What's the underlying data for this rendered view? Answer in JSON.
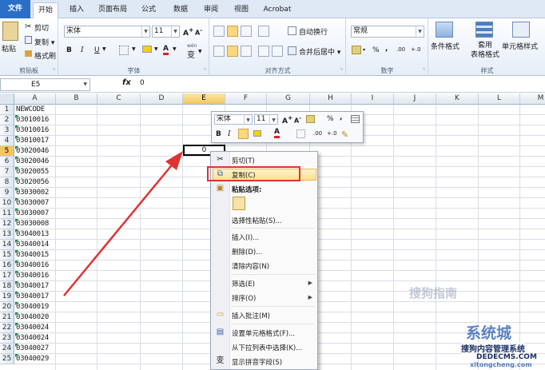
{
  "tabs": {
    "file": "文件",
    "home": "开始",
    "insert": "插入",
    "layout": "页面布局",
    "formula": "公式",
    "data": "数据",
    "review": "审阅",
    "view": "视图",
    "acrobat": "Acrobat"
  },
  "ribbon": {
    "clipboard": {
      "label": "剪贴板",
      "paste": "粘贴",
      "cut": "剪切",
      "copy": "复制 ▾",
      "painter": "格式刷"
    },
    "font": {
      "label": "字体",
      "name": "宋体",
      "size": "11",
      "bold": "B",
      "italic": "I",
      "underline": "U",
      "wen": "wén",
      "wen_char": "变"
    },
    "align": {
      "label": "对齐方式",
      "wrap": "自动换行",
      "merge": "合并后居中 ▾"
    },
    "number": {
      "label": "数字",
      "format": "常规",
      "currency": "▾",
      "percent": "%",
      "comma": ",",
      "dec_inc": ".00",
      "dec_dec": "+.0"
    },
    "styles": {
      "label": "样式",
      "cond": "条件格式",
      "table": "套用\n表格格式",
      "cell": "单元格样式"
    }
  },
  "formula_bar": {
    "name_box": "E5",
    "fx": "fx",
    "value": "0"
  },
  "columns": [
    "A",
    "B",
    "C",
    "D",
    "E",
    "F",
    "G",
    "H",
    "I",
    "J",
    "K",
    "L",
    "M"
  ],
  "rows": [
    "1",
    "2",
    "3",
    "4",
    "5",
    "6",
    "7",
    "8",
    "9",
    "10",
    "11",
    "12",
    "13",
    "14",
    "15",
    "16",
    "17",
    "18",
    "19",
    "20",
    "21",
    "22",
    "23",
    "24",
    "25"
  ],
  "cells_a": [
    "NEWCODE",
    "03010016",
    "03010016",
    "03010017",
    "03020046",
    "03020046",
    "03020055",
    "03020056",
    "03030002",
    "03030007",
    "03030007",
    "03030008",
    "03040013",
    "03040014",
    "03040015",
    "03040016",
    "03040016",
    "03040017",
    "03040017",
    "03040019",
    "03040020",
    "03040024",
    "03040024",
    "03040027",
    "03040029"
  ],
  "active_cell": {
    "ref": "E5",
    "value": "0"
  },
  "mini_toolbar": {
    "font": "宋体",
    "size": "11",
    "bold": "B",
    "italic": "I"
  },
  "context_menu": {
    "cut": "剪切(T)",
    "copy": "复制(C)",
    "paste_options": "粘贴选项:",
    "paste_special": "选择性粘贴(S)...",
    "insert": "插入(I)...",
    "delete": "删除(D)...",
    "clear": "清除内容(N)",
    "filter": "筛选(E)",
    "sort": "排序(O)",
    "insert_comment": "插入批注(M)",
    "format_cells": "设置单元格格式(F)...",
    "pick_list": "从下拉列表中选择(K)...",
    "phonetic": "显示拼音字段(S)"
  },
  "watermarks": {
    "w1": "搜狗指南",
    "w2": "系统城",
    "w3": "搜狗内容管理系统",
    "w4": "DEDECMS.COM",
    "w5": "xitongcheng.com"
  },
  "colors": {
    "accent": "#2a6fc7",
    "arrow": "#e03232",
    "highlight": "#fde08f",
    "selected_header": "#f5c659"
  }
}
